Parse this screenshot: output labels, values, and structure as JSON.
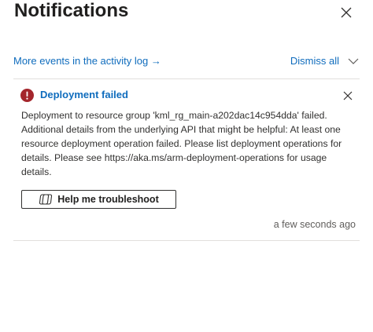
{
  "header": {
    "title": "Notifications",
    "close_icon": "close-icon"
  },
  "actions": {
    "activity_link": "More events in the activity log →",
    "dismiss_all": "Dismiss all",
    "dismiss_chevron_icon": "chevron-down-icon"
  },
  "notification": {
    "status_icon": "error-icon",
    "status_color": "#a4262c",
    "title": "Deployment failed",
    "body": "Deployment to resource group 'kml_rg_main-a202dac14c954dda' failed. Additional details from the underlying API that might be helpful: At least one resource deployment operation failed. Please list deployment operations for details. Please see https://aka.ms/arm-deployment-operations for usage details.",
    "button_label": "Help me troubleshoot",
    "button_icon": "copilot-icon",
    "timestamp": "a few seconds ago"
  },
  "colors": {
    "link": "#0f6cbd",
    "error": "#a4262c",
    "divider": "#e1dfdd"
  }
}
